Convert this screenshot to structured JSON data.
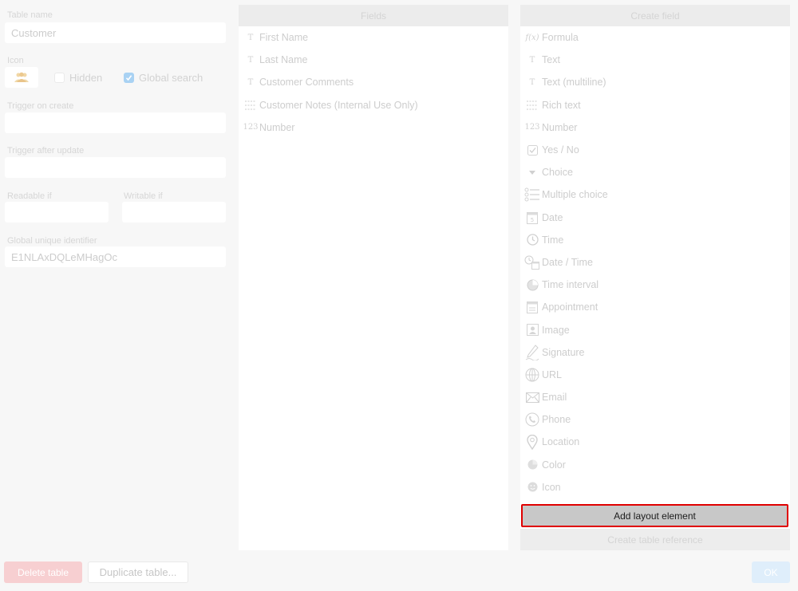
{
  "settings": {
    "table_name_label": "Table name",
    "table_name_value": "Customer",
    "icon_label": "Icon",
    "hidden_label": "Hidden",
    "hidden_checked": false,
    "global_search_label": "Global search",
    "global_search_checked": true,
    "trigger_on_create_label": "Trigger on create",
    "trigger_on_create_value": "",
    "trigger_after_update_label": "Trigger after update",
    "trigger_after_update_value": "",
    "readable_if_label": "Readable if",
    "readable_if_value": "",
    "writable_if_label": "Writable if",
    "writable_if_value": "",
    "guid_label": "Global unique identifier",
    "guid_value": "E1NLAxDQLeMHagOc",
    "delete_button": "Delete table",
    "duplicate_button": "Duplicate table..."
  },
  "fields": {
    "header": "Fields",
    "items": [
      {
        "icon": "T",
        "icon_name": "text-icon",
        "label": "First Name"
      },
      {
        "icon": "T",
        "icon_name": "text-icon",
        "label": "Last Name"
      },
      {
        "icon": "T",
        "icon_name": "text-icon",
        "label": "Customer Comments"
      },
      {
        "icon": "",
        "icon_name": "rich-text-icon",
        "label": "Customer Notes (Internal Use Only)"
      },
      {
        "icon": "123",
        "icon_name": "number-icon",
        "label": "Number"
      }
    ]
  },
  "create_field": {
    "header": "Create field",
    "items": [
      {
        "icon_name": "formula-icon",
        "icon": "f(x)",
        "label": "Formula"
      },
      {
        "icon_name": "text-icon",
        "icon": "T",
        "label": "Text"
      },
      {
        "icon_name": "text-multiline-icon",
        "icon": "T",
        "label": "Text (multiline)"
      },
      {
        "icon_name": "rich-text-icon",
        "icon": "",
        "label": "Rich text"
      },
      {
        "icon_name": "number-icon",
        "icon": "123",
        "label": "Number"
      },
      {
        "icon_name": "checkbox-icon",
        "icon": "",
        "label": "Yes / No"
      },
      {
        "icon_name": "dropdown-triangle-icon",
        "icon": "",
        "label": "Choice"
      },
      {
        "icon_name": "multiple-choice-icon",
        "icon": "",
        "label": "Multiple choice"
      },
      {
        "icon_name": "calendar-icon",
        "icon": "",
        "label": "Date"
      },
      {
        "icon_name": "clock-icon",
        "icon": "",
        "label": "Time"
      },
      {
        "icon_name": "date-time-icon",
        "icon": "",
        "label": "Date / Time"
      },
      {
        "icon_name": "time-interval-icon",
        "icon": "",
        "label": "Time interval"
      },
      {
        "icon_name": "appointment-icon",
        "icon": "",
        "label": "Appointment"
      },
      {
        "icon_name": "image-icon",
        "icon": "",
        "label": "Image"
      },
      {
        "icon_name": "signature-pen-icon",
        "icon": "",
        "label": "Signature"
      },
      {
        "icon_name": "globe-icon",
        "icon": "",
        "label": "URL"
      },
      {
        "icon_name": "envelope-icon",
        "icon": "",
        "label": "Email"
      },
      {
        "icon_name": "phone-icon",
        "icon": "",
        "label": "Phone"
      },
      {
        "icon_name": "location-pin-icon",
        "icon": "",
        "label": "Location"
      },
      {
        "icon_name": "color-icon",
        "icon": "",
        "label": "Color"
      },
      {
        "icon_name": "smiley-icon",
        "icon": "",
        "label": "Icon"
      }
    ],
    "add_layout_button": "Add layout element",
    "create_reference_button": "Create table reference"
  },
  "ok_button": "OK",
  "colors": {
    "highlight_border": "#e00000",
    "delete_button_bg": "#f7cfd1",
    "ok_button_bg": "#dfeefb",
    "checkbox_checked": "#a9d2f3"
  }
}
